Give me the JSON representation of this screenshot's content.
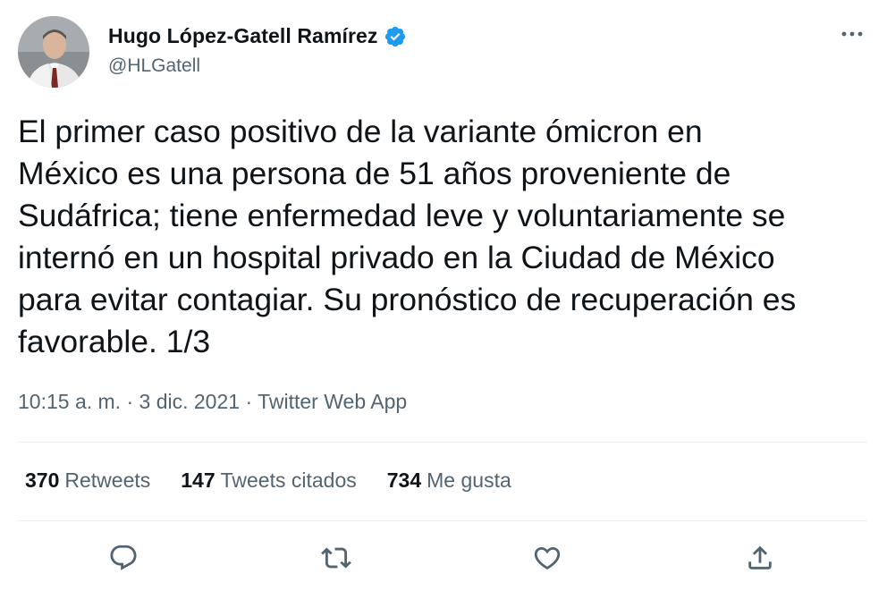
{
  "author": {
    "display_name": "Hugo López-Gatell Ramírez",
    "handle": "@HLGatell",
    "verified": true,
    "avatar_icon": "profile-photo"
  },
  "tweet": {
    "text": "El primer caso positivo de la variante ómicron en\nMéxico es una persona de 51 años proveniente de\nSudáfrica; tiene enfermedad leve y voluntariamente se\ninternó en un hospital privado en la Ciudad de México\npara evitar contagiar. Su pronóstico de recuperación es\nfavorable. 1/3"
  },
  "meta": {
    "time": "10:15 a. m.",
    "separator": "·",
    "date": "3 dic. 2021",
    "source": "Twitter Web App"
  },
  "stats": {
    "retweets_count": "370",
    "retweets_label": "Retweets",
    "quotes_count": "147",
    "quotes_label": "Tweets citados",
    "likes_count": "734",
    "likes_label": "Me gusta"
  },
  "actions": {
    "icons": [
      "reply-icon",
      "retweet-icon",
      "like-icon",
      "share-icon"
    ]
  },
  "colors": {
    "text_primary": "#0f1419",
    "text_secondary": "#536471",
    "verified_blue": "#1d9bf0",
    "divider": "#eff3f4"
  }
}
